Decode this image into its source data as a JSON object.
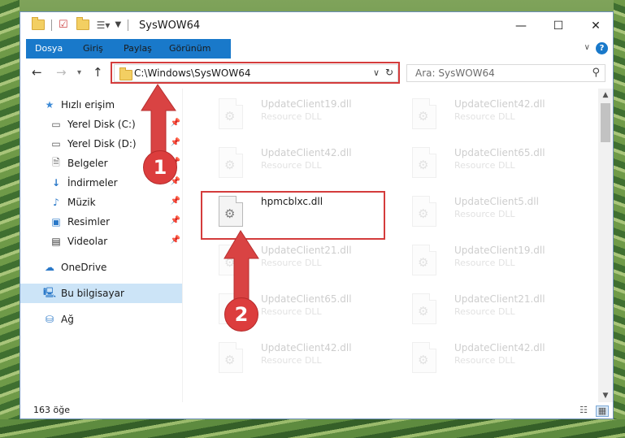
{
  "window": {
    "title": "SysWOW64",
    "controls": {
      "minimize": "—",
      "maximize": "☐",
      "close": "✕"
    }
  },
  "ribbon": {
    "tabs": [
      "Dosya",
      "Giriş",
      "Paylaş",
      "Görünüm"
    ],
    "help": "?"
  },
  "navbar": {
    "address": "C:\\Windows\\SysWOW64",
    "search_placeholder": "Ara: SysWOW64"
  },
  "sidebar": {
    "items": [
      {
        "label": "Hızlı erişim",
        "icon": "star-icon",
        "pinned": false
      },
      {
        "label": "Yerel Disk (C:)",
        "icon": "drive-icon",
        "pinned": true
      },
      {
        "label": "Yerel Disk (D:)",
        "icon": "drive-icon",
        "pinned": true
      },
      {
        "label": "Belgeler",
        "icon": "document-icon",
        "pinned": true
      },
      {
        "label": "İndirmeler",
        "icon": "download-icon",
        "pinned": true
      },
      {
        "label": "Müzik",
        "icon": "music-icon",
        "pinned": true
      },
      {
        "label": "Resimler",
        "icon": "pictures-icon",
        "pinned": true
      },
      {
        "label": "Videolar",
        "icon": "video-icon",
        "pinned": true
      },
      {
        "label": "OneDrive",
        "icon": "cloud-icon",
        "pinned": false
      },
      {
        "label": "Bu bilgisayar",
        "icon": "computer-icon",
        "pinned": false,
        "selected": true
      },
      {
        "label": "Ağ",
        "icon": "network-icon",
        "pinned": false
      }
    ]
  },
  "files": {
    "left": [
      {
        "name": "UpdateClient19.dll",
        "desc": "Resource DLL"
      },
      {
        "name": "UpdateClient42.dll",
        "desc": "Resource DLL"
      },
      {
        "name": "hpmcblxc.dll",
        "desc": ""
      },
      {
        "name": "UpdateClient21.dll",
        "desc": "Resource DLL"
      },
      {
        "name": "UpdateClient65.dll",
        "desc": "Resource DLL"
      },
      {
        "name": "UpdateClient42.dll",
        "desc": "Resource DLL"
      }
    ],
    "right": [
      {
        "name": "UpdateClient42.dll",
        "desc": "Resource DLL"
      },
      {
        "name": "UpdateClient65.dll",
        "desc": "Resource DLL"
      },
      {
        "name": "UpdateClient5.dll",
        "desc": "Resource DLL"
      },
      {
        "name": "UpdateClient19.dll",
        "desc": "Resource DLL"
      },
      {
        "name": "UpdateClient21.dll",
        "desc": "Resource DLL"
      },
      {
        "name": "UpdateClient42.dll",
        "desc": "Resource DLL"
      }
    ]
  },
  "status": {
    "count": "163 öğe"
  },
  "annotations": {
    "step1": "1",
    "step2": "2"
  },
  "colors": {
    "accent": "#1979ca",
    "highlight": "#d43c3c",
    "selected": "#cce4f7"
  }
}
